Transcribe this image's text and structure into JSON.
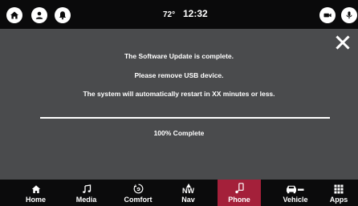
{
  "status_bar": {
    "left_buttons": [
      {
        "icon": "home-icon"
      },
      {
        "icon": "user-icon"
      },
      {
        "icon": "bell-icon"
      }
    ],
    "temperature": "72°",
    "time": "12:32",
    "right_buttons": [
      {
        "icon": "camera-icon"
      },
      {
        "icon": "microphone-icon"
      }
    ]
  },
  "dialog": {
    "close_icon": "close-icon",
    "line1": "The Software Update is complete.",
    "line2": "Please remove USB device.",
    "line3": "The system will automatically restart in XX minutes or less.",
    "progress": 1.0,
    "progress_text": "100% Complete"
  },
  "nav": {
    "items": [
      {
        "label": "Home",
        "icon": "home-icon",
        "active": false
      },
      {
        "label": "Media",
        "icon": "music-note-icon",
        "active": false
      },
      {
        "label": "Comfort",
        "icon": "climate-icon",
        "active": false
      },
      {
        "label": "Nav",
        "icon": "compass-icon",
        "compass": "NW",
        "active": false
      },
      {
        "label": "Phone",
        "icon": "phone-icon",
        "active": true
      },
      {
        "label": "Vehicle",
        "icon": "car-icon",
        "active": false
      },
      {
        "label": "Apps",
        "icon": "grid-icon",
        "active": false
      }
    ]
  },
  "colors": {
    "background": "#4a4b4d",
    "bars": "#0b0b0c",
    "accent": "#a4203a",
    "text": "#ffffff"
  }
}
